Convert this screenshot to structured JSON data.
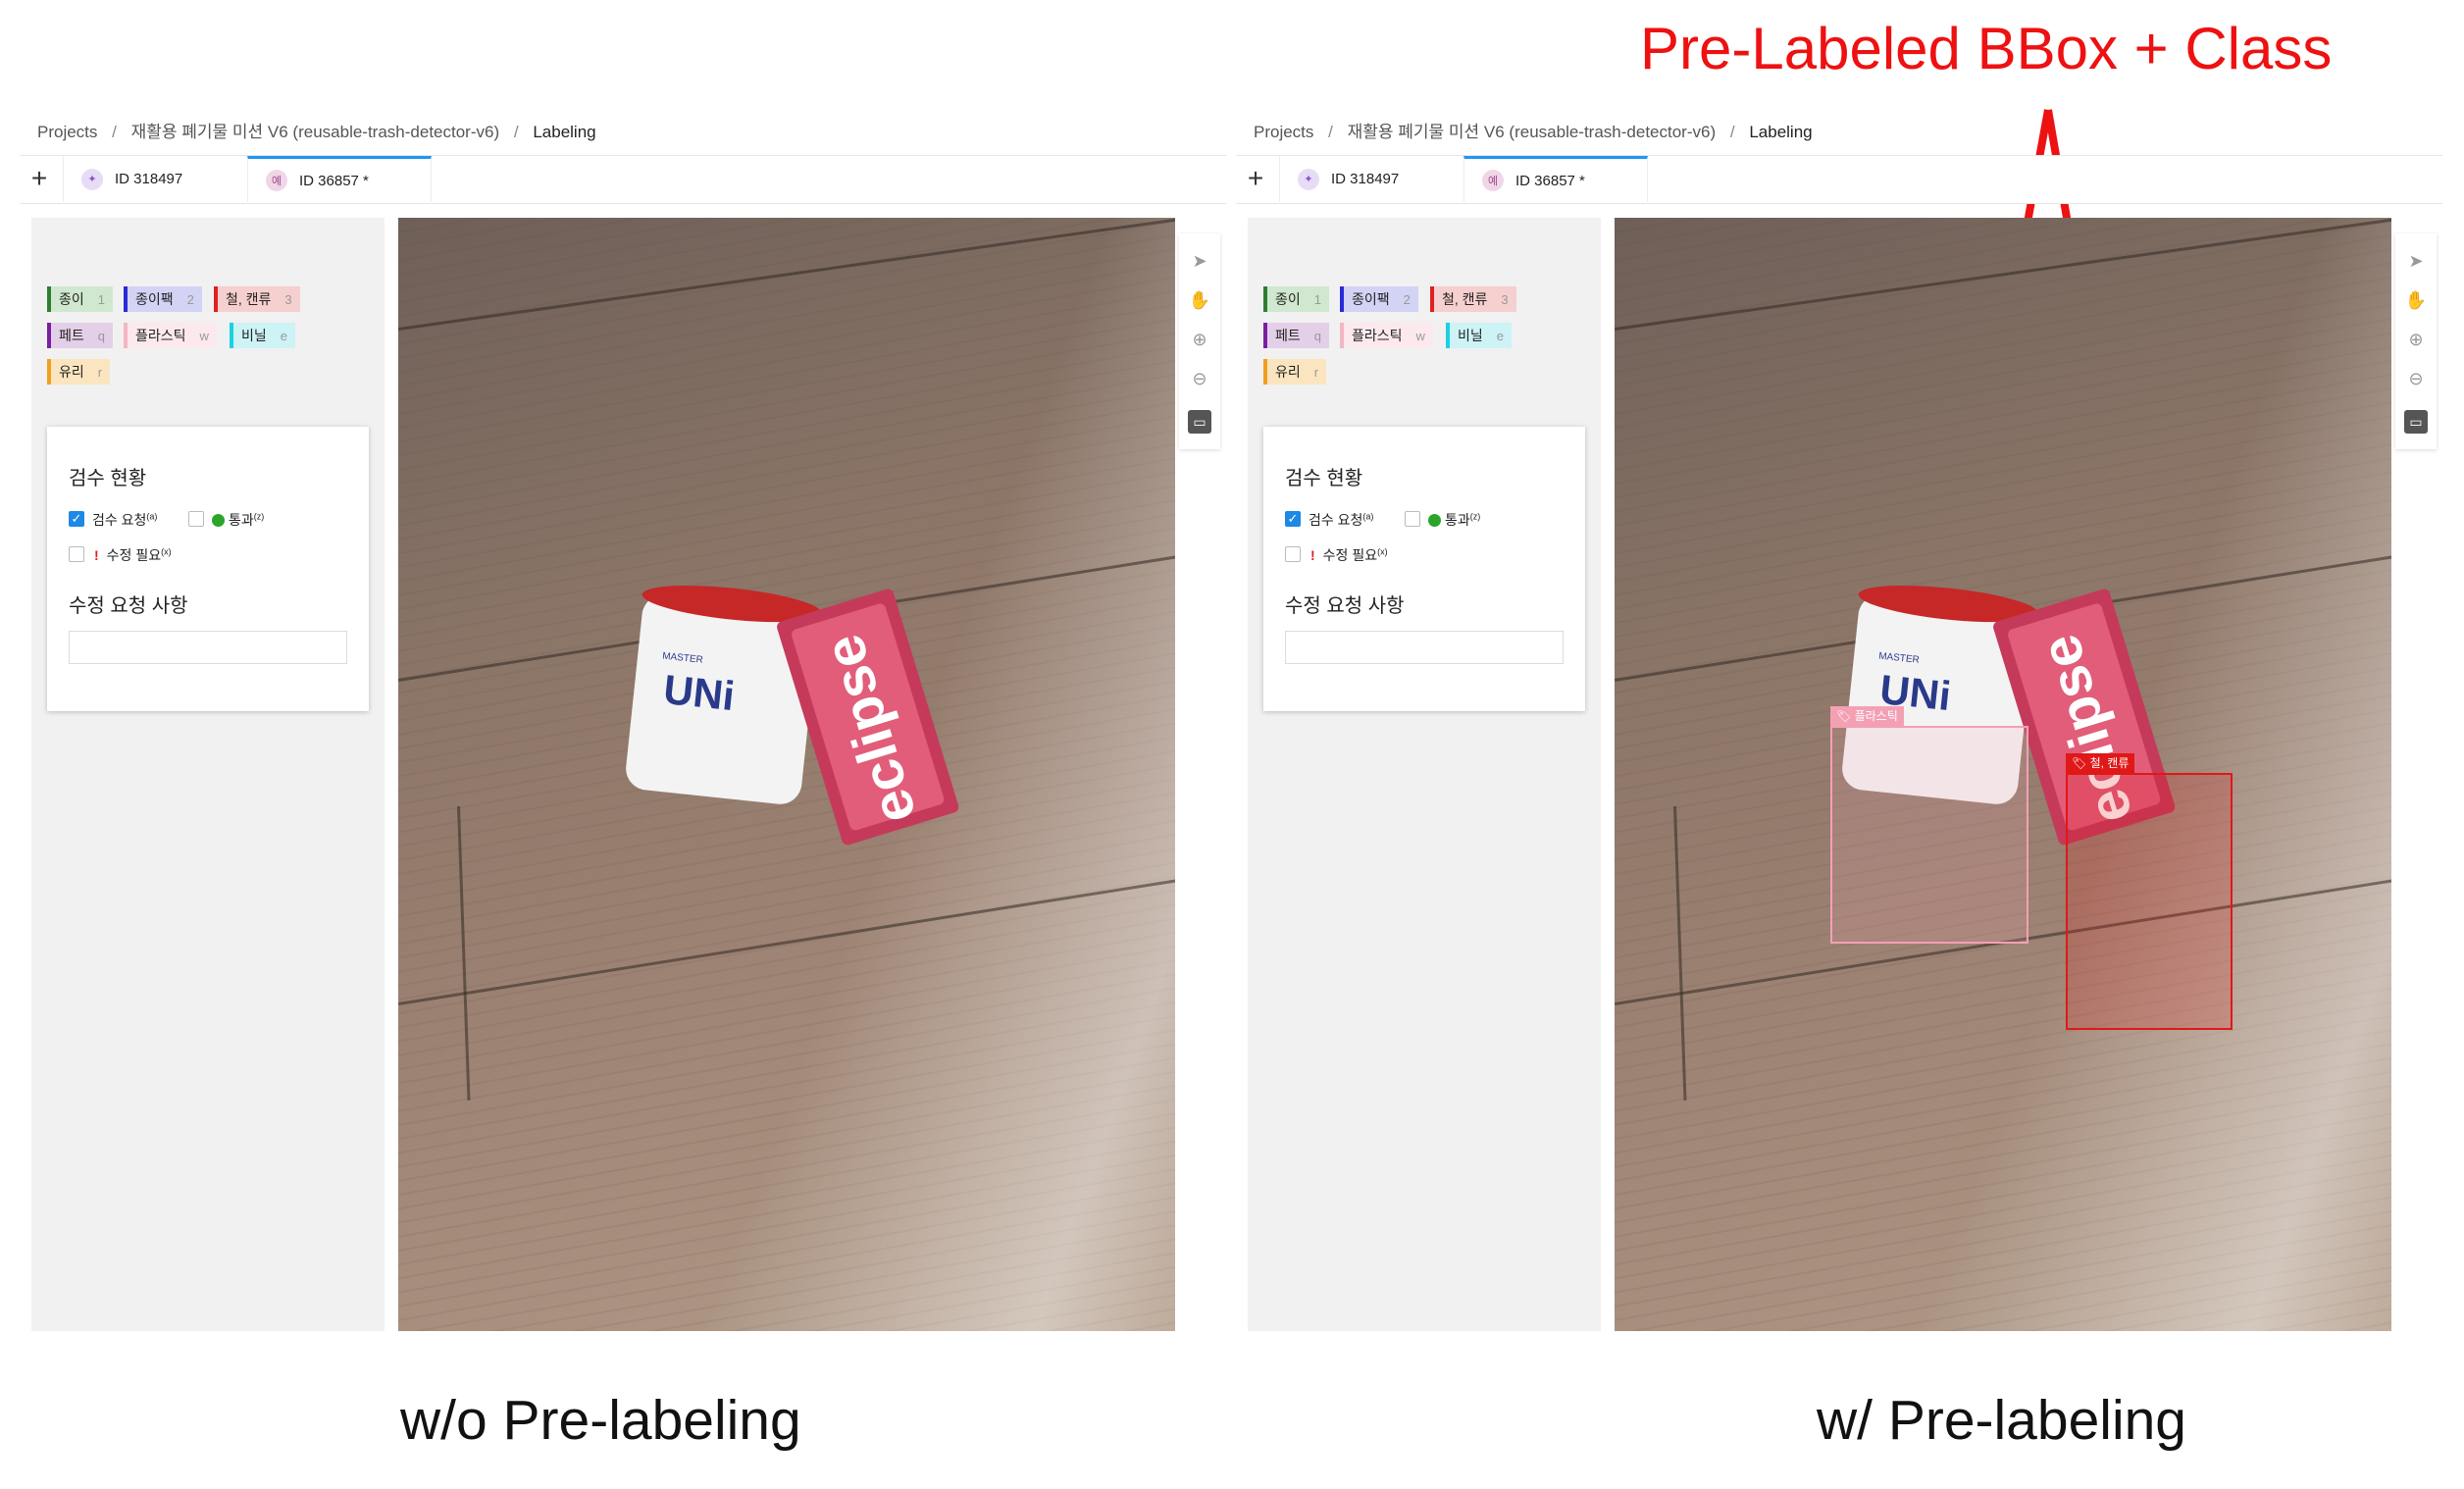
{
  "annotation": {
    "title": "Pre-Labeled BBox + Class",
    "arrow_color": "#ee1111"
  },
  "captions": {
    "left": "w/o Pre-labeling",
    "right": "w/ Pre-labeling"
  },
  "ui": {
    "breadcrumb": [
      "Projects",
      "재활용 폐기물 미션 V6 (reusable-trash-detector-v6)",
      "Labeling"
    ],
    "breadcrumb_sep": "/",
    "tabs": [
      {
        "icon_text": "✦",
        "label": "ID 318497"
      },
      {
        "icon_text": "예",
        "label": "ID 36857 *"
      }
    ],
    "add_tab_label": "+",
    "classes": [
      {
        "name": "종이",
        "hotkey": "1",
        "color": "#2e7d32",
        "bg": "#cfe8cf"
      },
      {
        "name": "종이팩",
        "hotkey": "2",
        "color": "#2a2ad9",
        "bg": "#d3d3f5"
      },
      {
        "name": "철, 캔류",
        "hotkey": "3",
        "color": "#e02020",
        "bg": "#f6cfcf"
      },
      {
        "name": "페트",
        "hotkey": "q",
        "color": "#7b1fa2",
        "bg": "#e4cfe8"
      },
      {
        "name": "플라스틱",
        "hotkey": "w",
        "color": "#f4b6c2",
        "bg": "#fbe9ed"
      },
      {
        "name": "비닐",
        "hotkey": "e",
        "color": "#1ad1e0",
        "bg": "#cdf3f6"
      },
      {
        "name": "유리",
        "hotkey": "r",
        "color": "#f0a020",
        "bg": "#fbe5c0"
      }
    ],
    "review": {
      "title": "검수 현황",
      "options": [
        {
          "label": "검수 요청",
          "sup": "(a)",
          "checked": true
        },
        {
          "label": "통과",
          "sup": "(z)",
          "checked": false
        },
        {
          "label": "수정 필요",
          "sup": "(x)",
          "checked": false
        }
      ],
      "request_title": "수정 요청 사항",
      "request_value": ""
    },
    "image_objects": {
      "cup_text": "UNi",
      "cup_brand_small": "MASTER",
      "pack_text": "eclipse"
    },
    "prelabels": [
      {
        "class": "플라스틱",
        "color": "#f4a0b4"
      },
      {
        "class": "철, 캔류",
        "color": "#e01818"
      }
    ]
  }
}
